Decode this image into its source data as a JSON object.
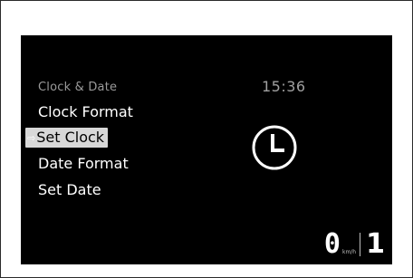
{
  "menu": {
    "title": "Clock & Date",
    "items": [
      {
        "label": "Clock Format"
      },
      {
        "label": "Set Clock",
        "selected": true
      },
      {
        "label": "Date Format"
      },
      {
        "label": "Set Date"
      }
    ],
    "selected_indicator": "⇨"
  },
  "status": {
    "time": "15:36",
    "speed": "0",
    "speed_unit": "km/h",
    "gear": "1"
  },
  "icons": {
    "clock": "clock-icon"
  },
  "colors": {
    "background": "#000000",
    "text": "#ffffff",
    "muted": "#9a9a9a",
    "highlight": "#d8d8d8"
  }
}
